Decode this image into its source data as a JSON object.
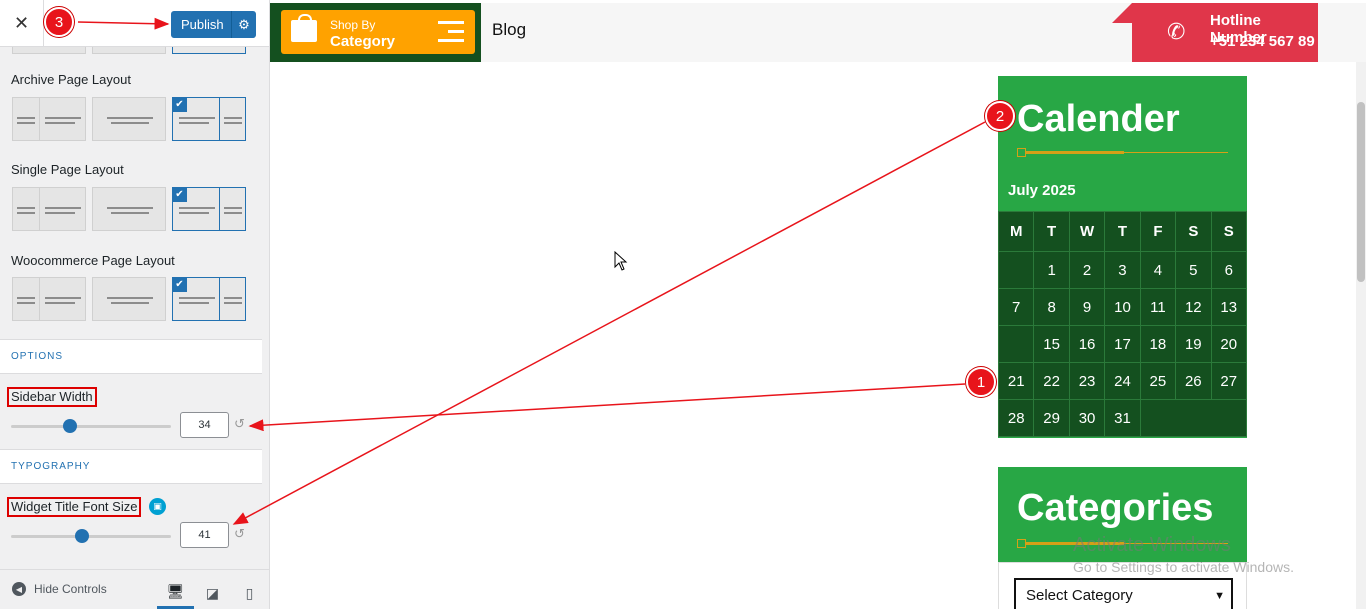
{
  "customizer": {
    "close_icon": "close-icon",
    "publish_label": "Publish",
    "publish_settings_icon": "gear-icon",
    "layouts": [
      {
        "label": "Archive Page Layout"
      },
      {
        "label": "Single Page Layout"
      },
      {
        "label": "Woocommerce Page Layout"
      }
    ],
    "options_section": "OPTIONS",
    "sidebar_width_label": "Sidebar Width",
    "sidebar_width_value": "34",
    "sidebar_width_level": 34,
    "typography_section": "TYPOGRAPHY",
    "widget_title_font_label": "Widget Title Font Size",
    "widget_title_font_value": "41",
    "widget_title_font_level": 41,
    "hide_controls_label": "Hide Controls",
    "devices": [
      "desktop-icon",
      "tablet-icon",
      "mobile-icon"
    ]
  },
  "preview": {
    "shop_small": "Shop By",
    "shop_big": "Category",
    "blog_label": "Blog",
    "hotline_title": "Hotline Number",
    "hotline_number": "+51 234 567 89",
    "calendar": {
      "title": "Calender",
      "month": "July 2025",
      "days": [
        "M",
        "T",
        "W",
        "T",
        "F",
        "S",
        "S"
      ],
      "weeks": [
        [
          "",
          "1",
          "2",
          "3",
          "4",
          "5",
          "6"
        ],
        [
          "7",
          "8",
          "9",
          "10",
          "11",
          "12",
          "13"
        ],
        [
          "",
          "15",
          "16",
          "17",
          "18",
          "19",
          "20"
        ],
        [
          "21",
          "22",
          "23",
          "24",
          "25",
          "26",
          "27"
        ],
        [
          "28",
          "29",
          "30",
          "31",
          "",
          "",
          ""
        ]
      ]
    },
    "categories": {
      "title": "Categories",
      "select_value": "Select Category"
    }
  },
  "watermark": {
    "line1": "Activate Windows",
    "line2": "Go to Settings to activate Windows."
  },
  "annotations": {
    "badge1": "1",
    "badge2": "2",
    "badge3": "3",
    "color": "#e8141b"
  }
}
